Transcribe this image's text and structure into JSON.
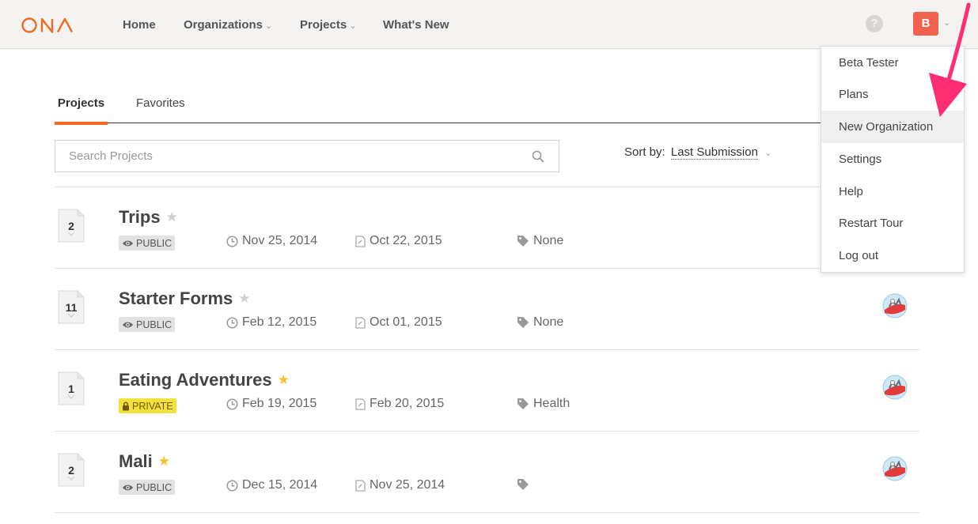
{
  "header": {
    "logo_text": "ONA",
    "nav": [
      {
        "label": "Home",
        "has_dropdown": false
      },
      {
        "label": "Organizations",
        "has_dropdown": true
      },
      {
        "label": "Projects",
        "has_dropdown": true
      },
      {
        "label": "What's New",
        "has_dropdown": false
      }
    ],
    "help_icon": "?",
    "user_initial": "B",
    "brand_color": "#f26a21",
    "avatar_color": "#f0624d"
  },
  "tabs": [
    {
      "label": "Projects",
      "active": true
    },
    {
      "label": "Favorites",
      "active": false
    }
  ],
  "search": {
    "placeholder": "Search Projects",
    "value": ""
  },
  "sort": {
    "label": "Sort by:",
    "value": "Last Submission"
  },
  "projects": [
    {
      "count": "2",
      "title": "Trips",
      "starred": false,
      "visibility": "PUBLIC",
      "created": "Nov 25, 2014",
      "updated": "Oct 22, 2015",
      "tags": "None",
      "shared_avatar": false
    },
    {
      "count": "11",
      "title": "Starter Forms",
      "starred": false,
      "visibility": "PUBLIC",
      "created": "Feb 12, 2015",
      "updated": "Oct 01, 2015",
      "tags": "None",
      "shared_avatar": true
    },
    {
      "count": "1",
      "title": "Eating Adventures",
      "starred": true,
      "visibility": "PRIVATE",
      "created": "Feb 19, 2015",
      "updated": "Feb 20, 2015",
      "tags": "Health",
      "shared_avatar": true
    },
    {
      "count": "2",
      "title": "Mali",
      "starred": true,
      "visibility": "PUBLIC",
      "created": "Dec 15, 2014",
      "updated": "Nov 25, 2014",
      "tags": "",
      "shared_avatar": true
    }
  ],
  "user_menu": {
    "items": [
      {
        "label": "Beta Tester",
        "highlighted": false
      },
      {
        "label": "Plans",
        "highlighted": false
      },
      {
        "label": "New Organization",
        "highlighted": true
      },
      {
        "label": "Settings",
        "highlighted": false
      },
      {
        "label": "Help",
        "highlighted": false
      },
      {
        "label": "Restart Tour",
        "highlighted": false
      },
      {
        "label": "Log out",
        "highlighted": false
      }
    ]
  },
  "annotation_color": "#ff2d72",
  "icons": {
    "search": "search-icon",
    "star": "star-icon",
    "clock": "clock-icon",
    "updated": "document-edit-icon",
    "tag": "tag-icon",
    "eye": "eye-icon",
    "lock": "lock-icon"
  }
}
